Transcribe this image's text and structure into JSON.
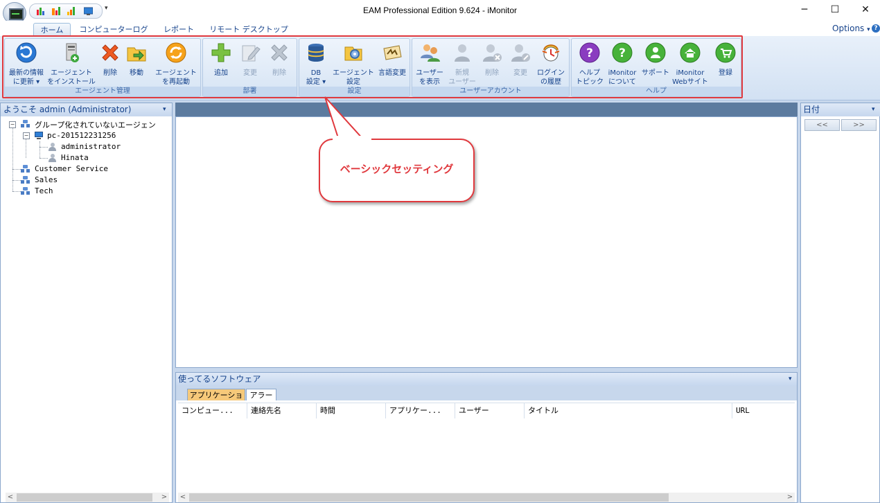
{
  "window": {
    "title": "EAM Professional Edition 9.624 - iMonitor",
    "minimize_glyph": "─",
    "maximize_glyph": "☐",
    "close_glyph": "✕"
  },
  "quick_access": {
    "dropdown_glyph": "▾"
  },
  "tabs": [
    {
      "label": "ホーム"
    },
    {
      "label": "コンピューターログ"
    },
    {
      "label": "レポート"
    },
    {
      "label": "リモート デスクトップ"
    }
  ],
  "options": {
    "label": "Options",
    "dropdown_glyph": "▾",
    "help_glyph": "?"
  },
  "ribbon": {
    "groups": [
      {
        "label": "エージェント管理"
      },
      {
        "label": "部署"
      },
      {
        "label": "設定"
      },
      {
        "label": "ユーザーアカウント"
      },
      {
        "label": "ヘルプ"
      }
    ],
    "buttons": {
      "refresh": "最新の情報\nに更新 ▾",
      "install_agent": "エージェント\nをインストール",
      "delete_agent": "削除",
      "move": "移動",
      "restart_agent": "エージェント\nを再起動",
      "add_dept": "追加",
      "edit_dept": "変更",
      "delete_dept": "削除",
      "db_settings": "DB\n設定 ▾",
      "agent_settings": "エージェント\n設定",
      "language": "言語変更",
      "show_users": "ユーザー\nを表示",
      "new_user": "新規\nユーザー",
      "delete_user": "削除",
      "edit_user": "変更",
      "login_history": "ログイン\nの履歴",
      "help_topics": "ヘルプ\nトピック",
      "about": "iMonitor\nについて",
      "support": "サポート",
      "website": "iMonitor\nWebサイト",
      "register": "登録"
    }
  },
  "left_panel": {
    "title": "ようこそ admin (Administrator)",
    "dropdown_glyph": "▾",
    "tree": {
      "ungrouped": "グループ化されていないエージェン",
      "pc": "pc-201512231256",
      "user1": "administrator",
      "user2": "Hinata",
      "group1": "Customer Service",
      "group2": "Sales",
      "group3": "Tech",
      "collapse_glyph": "−"
    }
  },
  "callout": {
    "text": "ベーシックセッティング"
  },
  "bottom_panel": {
    "title": "使ってるソフトウェア",
    "dropdown_glyph": "▾",
    "subtabs": [
      {
        "label": "アプリケーション"
      },
      {
        "label": "アラート"
      }
    ],
    "columns": [
      "コンピュー...",
      "連絡先名",
      "時間",
      "アプリケー...",
      "ユーザー",
      "タイトル",
      "URL"
    ]
  },
  "right_panel": {
    "title": "日付",
    "dropdown_glyph": "▾",
    "prev": "<<",
    "next": ">>"
  },
  "scroll": {
    "left": "<",
    "right": ">"
  },
  "colors": {
    "accent": "#15428b",
    "highlight": "#e0383d",
    "panel_bg": "#c7d7ec",
    "active_subtab": "#f6c97a"
  }
}
